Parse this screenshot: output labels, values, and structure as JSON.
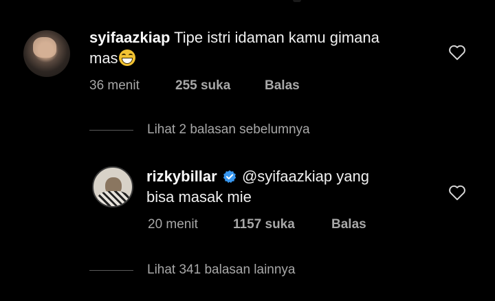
{
  "comments": [
    {
      "username": "syifaazkiap",
      "text_line1": "Tipe istri idaman kamu gimana",
      "text_line2": "mas",
      "emoji": "grinning-squinting-face",
      "time": "36 menit",
      "likes": "255 suka",
      "reply_label": "Balas"
    },
    {
      "username": "rizkybillar",
      "verified": true,
      "mention": "@syifaazkiap",
      "text_line1": " yang",
      "text_line2": "bisa masak mie",
      "time": "20 menit",
      "likes": "1157 suka",
      "reply_label": "Balas"
    }
  ],
  "threads": {
    "previous_replies": "Lihat 2 balasan sebelumnya",
    "more_replies": "Lihat 341 balasan lainnya"
  },
  "colors": {
    "background": "#000000",
    "text": "#f5f5f5",
    "secondary": "#a8a8a8",
    "verified": "#3897f0"
  }
}
